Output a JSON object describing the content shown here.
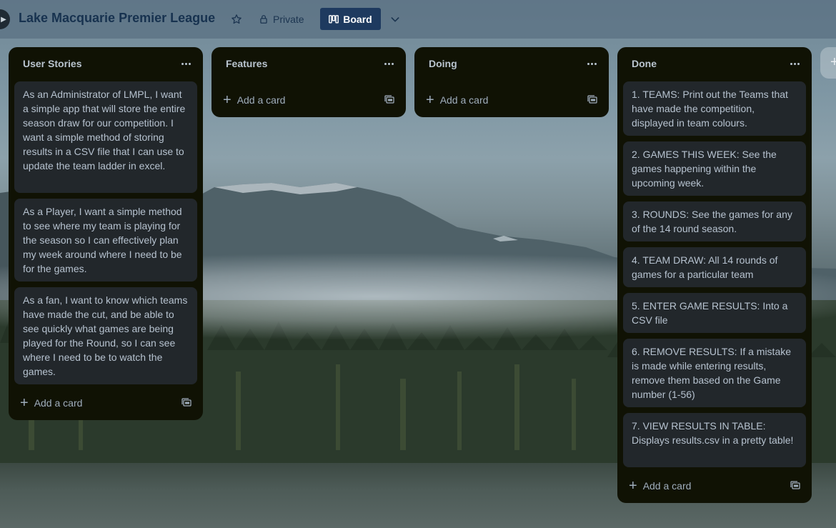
{
  "board": {
    "title": "Lake Macquarie Premier League",
    "visibility": "Private",
    "view": "Board"
  },
  "lists": [
    {
      "title": "User Stories",
      "cards": [
        "As an Administrator of LMPL, I want a simple app that will store the entire season draw for our competition. I want a simple method of storing results in a CSV file that I can use to update the team ladder in excel.",
        "As a Player, I want a simple method to see where my team is playing for the season so I can effectively plan my week around where I need to be for the games.",
        "As a fan, I want to know which teams have made the cut, and be able to see quickly what games are being played for the Round, so I can see where I need to be to watch the games."
      ],
      "add_card": "Add a card"
    },
    {
      "title": "Features",
      "cards": [],
      "add_card": "Add a card"
    },
    {
      "title": "Doing",
      "cards": [],
      "add_card": "Add a card"
    },
    {
      "title": "Done",
      "cards": [
        "1. TEAMS: Print out the Teams that have made the competition, displayed in team colours.",
        "2. GAMES THIS WEEK: See the games happening within the upcoming week.",
        "3. ROUNDS: See the games for any of the 14 round season.",
        "4. TEAM DRAW: All 14 rounds of games for a particular team",
        "5. ENTER GAME RESULTS: Into a CSV file",
        "6. REMOVE RESULTS: If a mistake is made while entering results, remove them based on the Game number (1-56)",
        "7. VIEW RESULTS IN TABLE: Displays results.csv in a pretty table!"
      ],
      "add_card": "Add a card"
    }
  ],
  "icons": {
    "star": "star-icon",
    "visibility": "lock-icon",
    "view": "board-view-icon",
    "views_menu": "chevron-down-icon",
    "list_menu": "more-horizontal-icon",
    "add": "plus-icon",
    "template": "card-template-icon"
  },
  "colors": {
    "list_background": "#101204",
    "card_background": "#22272b",
    "card_text": "#b6c2cf",
    "board_button": "#1e3a5f",
    "title": "#17324f"
  }
}
